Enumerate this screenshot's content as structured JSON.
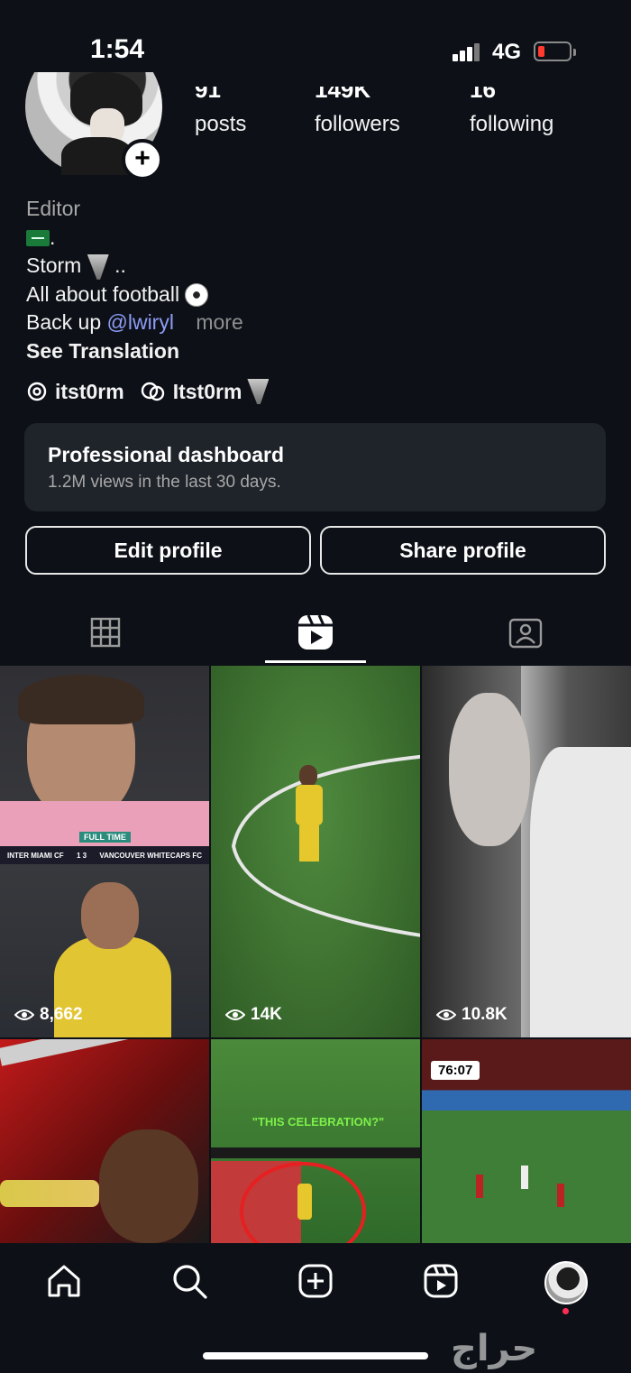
{
  "status": {
    "time": "1:54",
    "network": "4G"
  },
  "stats": [
    {
      "num": "91",
      "label": "posts"
    },
    {
      "num": "149K",
      "label": "followers"
    },
    {
      "num": "16",
      "label": "following"
    }
  ],
  "bio": {
    "category": "Editor",
    "line_storm": "Storm",
    "line_storm_suffix": "..",
    "line_football": "All about football",
    "backup_prefix": "Back up",
    "backup_link": "@lwiryl",
    "more": "more",
    "translation": "See Translation"
  },
  "links": {
    "threads": "itst0rm",
    "other": "Itst0rm"
  },
  "dashboard": {
    "title": "Professional dashboard",
    "subtitle": "1.2M views in the last 30 days."
  },
  "buttons": {
    "edit": "Edit profile",
    "share": "Share profile"
  },
  "grid": [
    {
      "views": "8,662",
      "overlay_score_left": "INTER MIAMI CF",
      "overlay_score": "1  3",
      "overlay_score_right": "VANCOUVER WHITECAPS FC",
      "overlay_tag": "FULL TIME"
    },
    {
      "views": "14K"
    },
    {
      "views": "10.8K"
    },
    {
      "views": ""
    },
    {
      "views": "",
      "caption": "\"THIS CELEBRATION?\""
    },
    {
      "views": "",
      "clock": "76:07"
    }
  ],
  "watermark": "حراج"
}
